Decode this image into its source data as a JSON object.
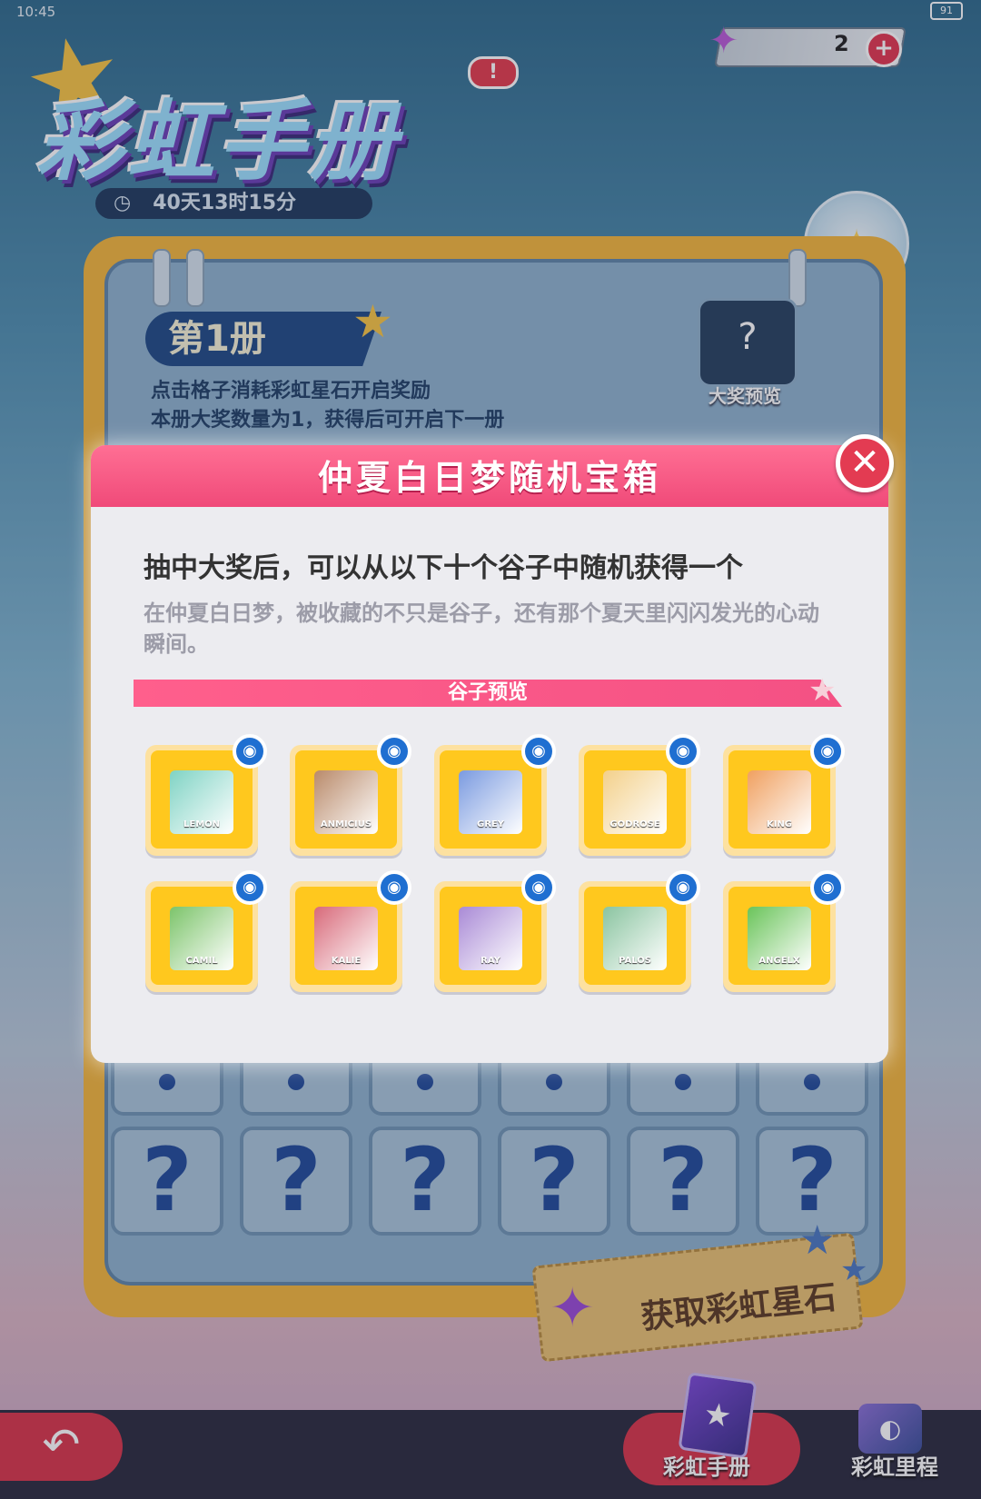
{
  "status": {
    "time": "10:45",
    "battery": "91"
  },
  "currency": {
    "count": "2",
    "plus": "+"
  },
  "title": {
    "text": "彩虹手册",
    "alert": "!",
    "countdown": "40天13时15分"
  },
  "notebook": {
    "volume": "第1册",
    "desc_line1": "点击格子消耗彩虹星石开启奖励",
    "desc_line2": "本册大奖数量为1，获得后可开启下一册",
    "grand_prize_label": "大奖预览",
    "mystery": "?"
  },
  "get_stone_button": "获取彩虹星石",
  "bottom_nav": {
    "tab1": "彩虹手册",
    "tab2": "彩虹里程"
  },
  "modal": {
    "title": "仲夏白日梦随机宝箱",
    "close": "✕",
    "headline": "抽中大奖后，可以从以下十个谷子中随机获得一个",
    "description": "在仲夏白日梦，被收藏的不只是谷子，还有那个夏天里闪闪发光的心动瞬间。",
    "preview_label": "谷子预览",
    "items": [
      {
        "name": "LEMON",
        "color": "#7fd3c4"
      },
      {
        "name": "ANMICIUS",
        "color": "#b98a6a"
      },
      {
        "name": "GREY",
        "color": "#7a9ae0"
      },
      {
        "name": "GODROSE",
        "color": "#f3d08a"
      },
      {
        "name": "KING",
        "color": "#f0a060"
      },
      {
        "name": "CAMIL",
        "color": "#7cc46a"
      },
      {
        "name": "KALIE",
        "color": "#d86a7a"
      },
      {
        "name": "RAY",
        "color": "#a98ad6"
      },
      {
        "name": "PALOS",
        "color": "#8ac4a0"
      },
      {
        "name": "ANGELX",
        "color": "#6ac45a"
      }
    ]
  }
}
